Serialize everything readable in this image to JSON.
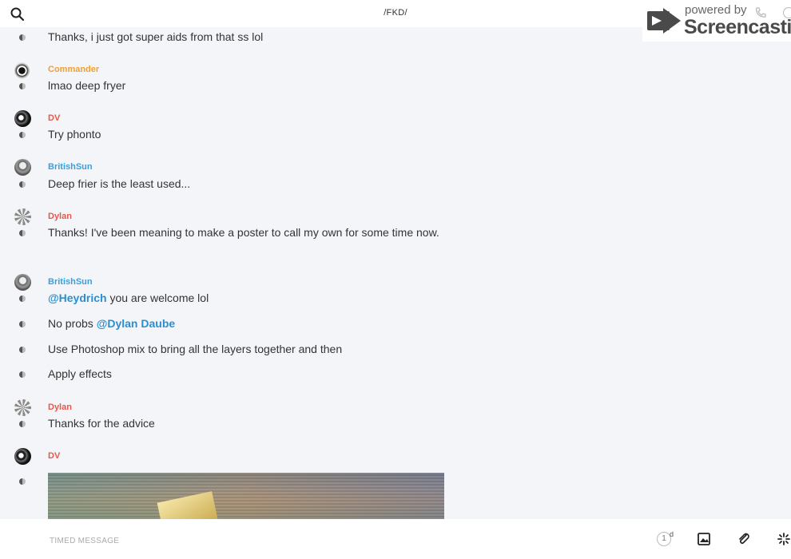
{
  "header": {
    "channel_title": "/FKD/",
    "search_icon": "search-icon"
  },
  "watermark": {
    "powered_by": "powered by",
    "brand": "Screencastify"
  },
  "messages": [
    {
      "user": "",
      "text": "Thanks, i just got super aids from that ss lol"
    },
    {
      "user": "Commander",
      "text": "lmao deep fryer"
    },
    {
      "user": "DV",
      "text": "Try phonto"
    },
    {
      "user": "BritishSun",
      "text": "Deep frier is the least used..."
    },
    {
      "user": "Dylan",
      "text": "Thanks! I've been meaning to make a poster to call my own for some time now."
    },
    {
      "user": "BritishSun",
      "mention": "@Heydrich",
      "text": " you are welcome lol"
    },
    {
      "user": "",
      "text": "No probs ",
      "mention": "@Dylan Daube"
    },
    {
      "user": "",
      "text": "Use Photoshop mix to bring all the layers together and then"
    },
    {
      "user": "",
      "text": "Apply effects"
    },
    {
      "user": "Dylan",
      "text": "Thanks for the advice"
    },
    {
      "user": "DV",
      "text": ""
    }
  ],
  "composer": {
    "placeholder": "TIMED MESSAGE",
    "timer_value": "1",
    "timer_unit": "d"
  },
  "colors": {
    "commander": "#f0a030",
    "dv": "#e25a4e",
    "dylan": "#e25a4e",
    "britishsun": "#3aa0dc",
    "mention": "#2a8fd0"
  }
}
